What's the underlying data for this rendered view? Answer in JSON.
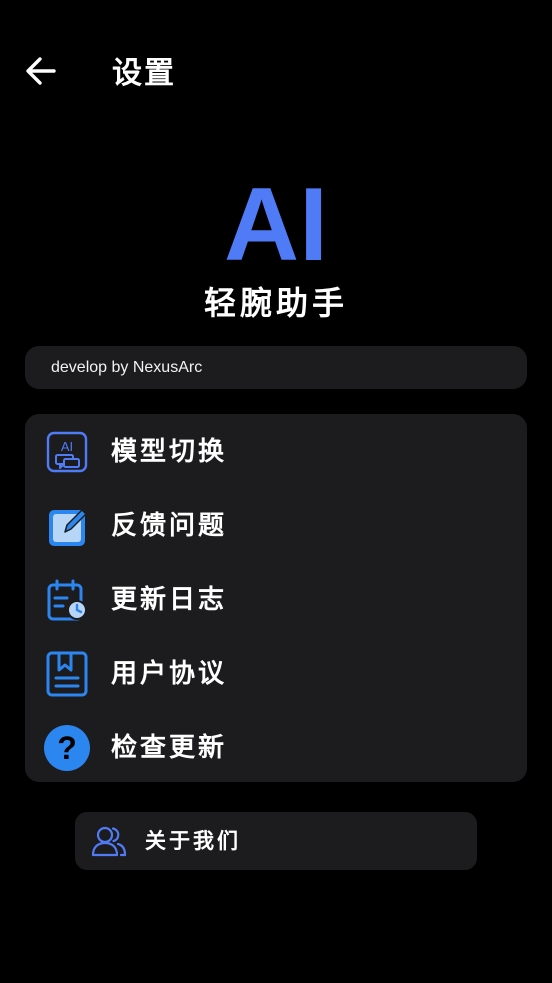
{
  "header": {
    "title": "设置",
    "back_icon": "arrow-left-icon"
  },
  "branding": {
    "logo_text": "AI",
    "logo_color": "#4f7cf6",
    "app_name": "轻腕助手",
    "developer_note": "develop by NexusArc"
  },
  "menu": {
    "items": [
      {
        "label": "模型切换",
        "icon": "ai-chat-icon"
      },
      {
        "label": "反馈问题",
        "icon": "edit-icon"
      },
      {
        "label": "更新日志",
        "icon": "calendar-clock-icon"
      },
      {
        "label": "用户协议",
        "icon": "bookmark-document-icon"
      },
      {
        "label": "检查更新",
        "icon": "question-circle-icon"
      }
    ]
  },
  "about": {
    "label": "关于我们",
    "icon": "users-icon"
  },
  "colors": {
    "background": "#000000",
    "card": "#1c1c1e",
    "accent": "#4f7cf6",
    "icon_blue": "#2b86f0",
    "text": "#ffffff"
  }
}
